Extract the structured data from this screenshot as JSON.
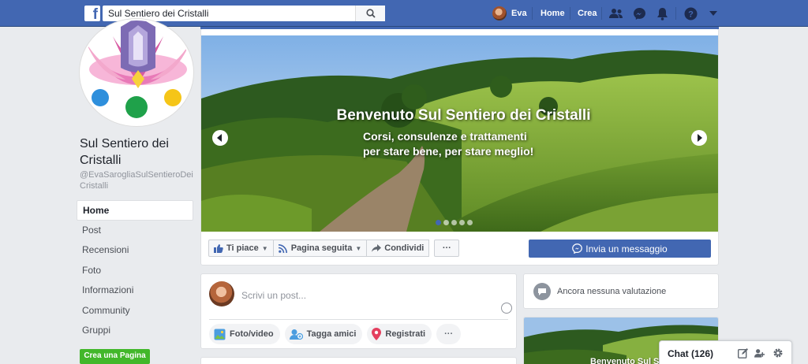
{
  "topbar": {
    "logo": "f",
    "search_value": "Sul Sentiero dei Cristalli",
    "user_name": "Eva",
    "home_label": "Home",
    "create_label": "Crea",
    "icons": [
      "search-icon",
      "friends-icon",
      "messenger-icon",
      "notifications-icon",
      "help-icon",
      "dropdown-icon"
    ]
  },
  "page": {
    "name": "Sul Sentiero dei Cristalli",
    "handle": "@EvaSarogliaSulSentieroDeiCristalli"
  },
  "sidebar": {
    "items": [
      {
        "label": "Home",
        "active": true
      },
      {
        "label": "Post"
      },
      {
        "label": "Recensioni"
      },
      {
        "label": "Foto"
      },
      {
        "label": "Informazioni"
      },
      {
        "label": "Community"
      },
      {
        "label": "Gruppi"
      }
    ],
    "create_page": "Crea una Pagina"
  },
  "cover": {
    "title": "Benvenuto Sul Sentiero dei Cristalli",
    "subtitle_line1": "Corsi, consulenze e trattamenti",
    "subtitle_line2": "per stare bene, per stare meglio!",
    "slides": 5,
    "active_slide": 1
  },
  "actions": {
    "like": "Ti piace",
    "follow": "Pagina seguita",
    "share": "Condividi",
    "more": "···",
    "message": "Invia un messaggio"
  },
  "composer": {
    "placeholder": "Scrivi un post...",
    "photo": "Foto/video",
    "tag": "Tagga amici",
    "checkin": "Registrati",
    "more": "···"
  },
  "ratings": {
    "text": "Ancora nessuna valutazione"
  },
  "thumb": {
    "title": "Benvenuto Sul Sentiero dei Cristalli"
  },
  "chat": {
    "label": "Chat (126)"
  },
  "colors": {
    "brand": "#4267b2",
    "green": "#42b72a"
  }
}
